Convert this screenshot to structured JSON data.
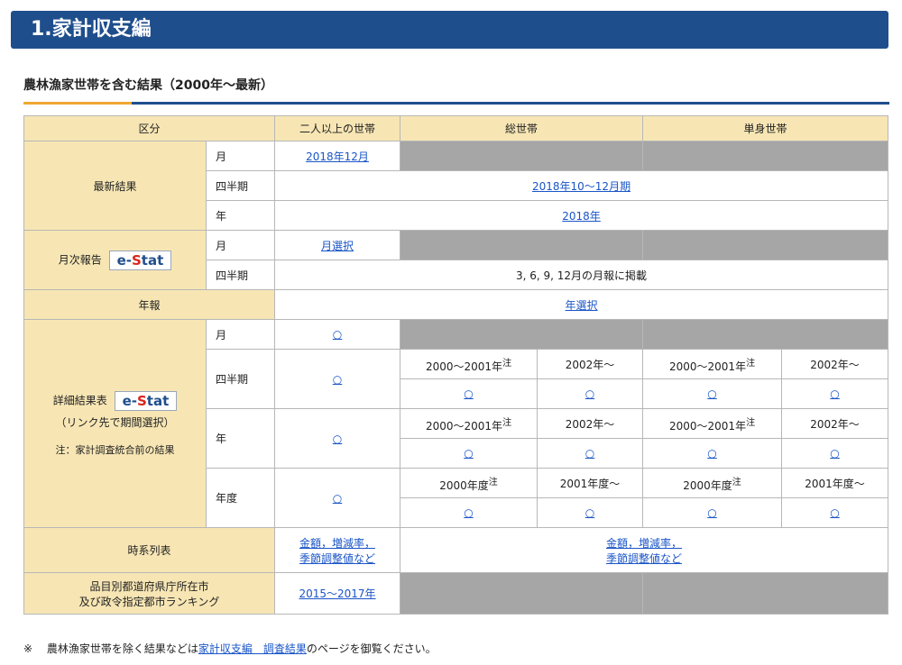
{
  "banner": {
    "title": "1.家計収支編"
  },
  "subhead": "農林漁家世帯を含む結果（2000年～最新）",
  "table": {
    "headers": [
      "区分",
      "二人以上の世帯",
      "総世帯",
      "単身世帯"
    ],
    "latest": {
      "label": "最新結果",
      "month": {
        "label": "月",
        "link": "2018年12月"
      },
      "quarter": {
        "label": "四半期",
        "link": "2018年10～12月期"
      },
      "year": {
        "label": "年",
        "link": "2018年"
      }
    },
    "monthly": {
      "label": "月次報告",
      "estat": "e-Stat",
      "month": {
        "label": "月",
        "link": "月選択"
      },
      "quarter": {
        "label": "四半期",
        "text": "3, 6, 9, 12月の月報に掲載"
      }
    },
    "annual": {
      "label": "年報",
      "link": "年選択"
    },
    "detail": {
      "label": "詳細結果表",
      "estat": "e-Stat",
      "sub": "（リンク先で期間選択）",
      "note": "注：家計調査統合前の結果",
      "month": {
        "label": "月",
        "link": "○"
      },
      "quarter": {
        "label": "四半期",
        "link": "○",
        "p1": "2000～2001年",
        "p2": "2002年～",
        "link_mark": "○"
      },
      "year": {
        "label": "年",
        "link": "○",
        "p1": "2000～2001年",
        "p2": "2002年～",
        "link_mark": "○"
      },
      "fiscal": {
        "label": "年度",
        "link": "○",
        "p1": "2000年度",
        "p2": "2001年度～",
        "link_mark": "○"
      },
      "note_mark": "注"
    },
    "timeseries": {
      "label": "時系列表",
      "link1": "金額，増減率，",
      "link2": "季節調整値など"
    },
    "ranking": {
      "label1": "品目別都道府県庁所在市",
      "label2": "及び政令指定都市ランキング",
      "link": "2015～2017年"
    }
  },
  "footnote": {
    "mark": "※",
    "text1": "農林漁家世帯を除く結果などは",
    "link": "家計収支編　調査結果",
    "text2": "のページを御覧ください。"
  },
  "colors": {
    "banner": "#1f4e8c",
    "header_bg": "#f7e6b4",
    "gray_cell": "#a6a6a6",
    "link": "#1a55c7",
    "accent": "#f0a830"
  }
}
